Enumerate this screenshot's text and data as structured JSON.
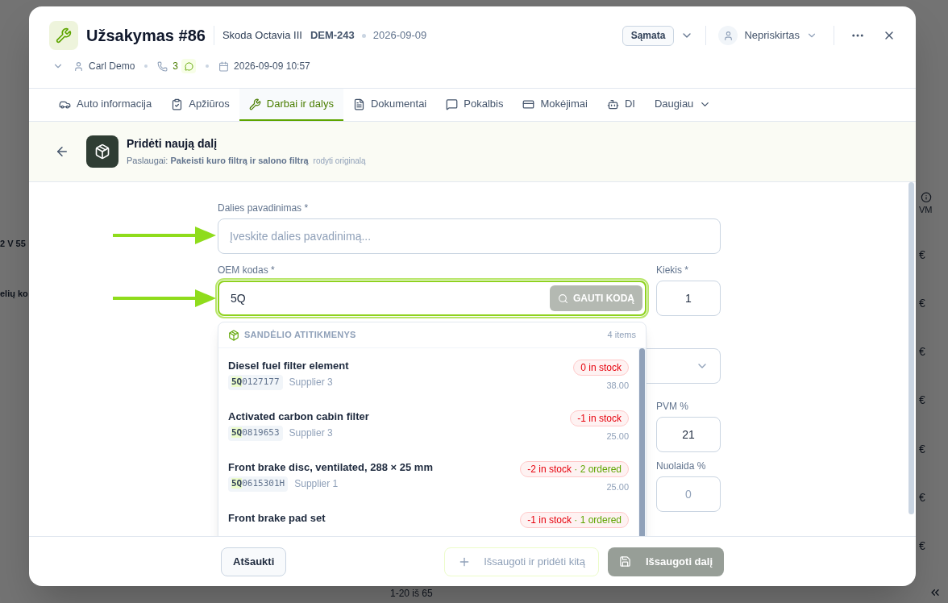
{
  "background": {
    "row_texts": [
      "2 V 55",
      "elių ko"
    ],
    "column_header": "VM",
    "price_cells": [
      "€",
      "€",
      "€",
      "€",
      "€",
      "€",
      "€"
    ],
    "pagination": "1-20 iš 65"
  },
  "order": {
    "title": "Užsakymas #86",
    "vehicle": "Skoda Octavia III",
    "plate": "DEM-243",
    "date": "2026-09-09",
    "status_button": "Sąmata",
    "assignee": "Nepriskirtas",
    "customer": "Carl Demo",
    "calls": "3",
    "created": "2026-09-09 10:57"
  },
  "tabs": [
    {
      "label": "Auto informacija",
      "kind": "tab",
      "selected": false
    },
    {
      "label": "Apžiūros",
      "kind": "tab",
      "selected": false
    },
    {
      "label": "Darbai ir dalys",
      "kind": "tab",
      "selected": true
    },
    {
      "label": "Dokumentai",
      "kind": "tab",
      "selected": false
    },
    {
      "label": "Pokalbis",
      "kind": "tab",
      "selected": false
    },
    {
      "label": "Mokėjimai",
      "kind": "tab",
      "selected": false
    },
    {
      "label": "DI",
      "kind": "tab",
      "selected": false
    },
    {
      "label": "Daugiau",
      "kind": "menu",
      "selected": false
    }
  ],
  "panel": {
    "title": "Pridėti naują dalį",
    "subtitle": "Paslaugai: **Pakeisti kuro filtrą ir salono filtrą**",
    "link": "rodyti originalą"
  },
  "form": {
    "name": {
      "label": "Dalies pavadinimas *",
      "placeholder": "Įveskite dalies pavadinimą..."
    },
    "oem": {
      "label": "OEM kodas *",
      "value": "5Q",
      "focused": true,
      "button": "GAUTI KODĄ"
    },
    "quantity": {
      "label": "Kiekis *",
      "value": "1"
    },
    "vat": {
      "label": "PVM %",
      "value": "21"
    },
    "discount": {
      "label": "Nuolaida %",
      "placeholder": "0"
    }
  },
  "matches": {
    "title": "SANDĖLIO ATITIKMENYS",
    "count": "4 items",
    "items": [
      {
        "name": "Diesel fuel filter element",
        "code_match": "5Q",
        "code_rest": "0127177",
        "supplier": "Supplier 3",
        "stock": "0 in stock",
        "price": "38.00"
      },
      {
        "name": "Activated carbon cabin filter",
        "code_match": "5Q",
        "code_rest": "0819653",
        "supplier": "Supplier 3",
        "stock": "-1 in stock",
        "price": "25.00"
      },
      {
        "name": "Front brake disc, ventilated, 288 × 25 mm",
        "code_match": "5Q",
        "code_rest": "0615301H",
        "supplier": "Supplier 1",
        "stock": "-2 in stock",
        "ordered": "· 2 ordered",
        "price": "25.00"
      },
      {
        "name": "Front brake pad set",
        "stock": "-1 in stock",
        "ordered": "· 1 ordered"
      }
    ]
  },
  "footer": {
    "cancel": "Atšaukti",
    "save_add": {
      "label": "Išsaugoti ir pridėti kitą",
      "disabled": true
    },
    "save": {
      "label": "Išsaugoti dalį",
      "disabled": true
    }
  }
}
